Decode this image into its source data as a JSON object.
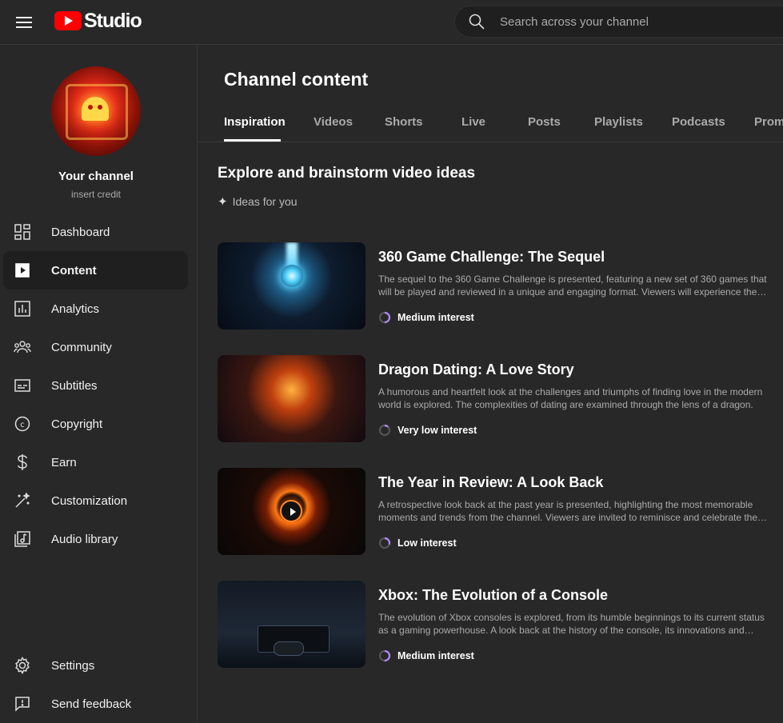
{
  "app": {
    "logo_text": "Studio",
    "brand_color": "#ff0000"
  },
  "search": {
    "placeholder": "Search across your channel"
  },
  "channel": {
    "name": "Your channel",
    "subtitle": "insert credit"
  },
  "sidebar": {
    "items": [
      {
        "label": "Dashboard",
        "icon": "dashboard-icon"
      },
      {
        "label": "Content",
        "icon": "content-icon",
        "active": true
      },
      {
        "label": "Analytics",
        "icon": "analytics-icon"
      },
      {
        "label": "Community",
        "icon": "community-icon"
      },
      {
        "label": "Subtitles",
        "icon": "subtitles-icon"
      },
      {
        "label": "Copyright",
        "icon": "copyright-icon"
      },
      {
        "label": "Earn",
        "icon": "dollar-icon"
      },
      {
        "label": "Customization",
        "icon": "magic-wand-icon"
      },
      {
        "label": "Audio library",
        "icon": "audio-library-icon"
      }
    ],
    "footer": [
      {
        "label": "Settings",
        "icon": "gear-icon"
      },
      {
        "label": "Send feedback",
        "icon": "feedback-icon"
      }
    ]
  },
  "main": {
    "title": "Channel content",
    "tabs": [
      "Inspiration",
      "Videos",
      "Shorts",
      "Live",
      "Posts",
      "Playlists",
      "Podcasts",
      "Prom"
    ],
    "active_tab": "Inspiration",
    "section_title": "Explore and brainstorm video ideas",
    "ideas_label": "Ideas for you",
    "ideas": [
      {
        "title": "360 Game Challenge: The Sequel",
        "description": "The sequel to the 360 Game Challenge is presented, featuring a new set of 360 games that will be played and reviewed in a unique and engaging format. Viewers will experience the excitement of discovering new titles.",
        "interest": "Medium interest",
        "interest_level": 0.5
      },
      {
        "title": "Dragon Dating: A Love Story",
        "description": "A humorous and heartfelt look at the challenges and triumphs of finding love in the modern world is explored. The complexities of dating are examined through the lens of a dragon.",
        "interest": "Very low interest",
        "interest_level": 0.12
      },
      {
        "title": "The Year in Review: A Look Back",
        "description": "A retrospective look back at the past year is presented, highlighting the most memorable moments and trends from the channel. Viewers are invited to reminisce and celebrate the year together.",
        "interest": "Low interest",
        "interest_level": 0.3
      },
      {
        "title": "Xbox: The Evolution of a Console",
        "description": "The evolution of Xbox consoles is explored, from its humble beginnings to its current status as a gaming powerhouse. A look back at the history of the console, its innovations and legacy.",
        "interest": "Medium interest",
        "interest_level": 0.5
      }
    ]
  },
  "colors": {
    "accent_interest": "#b388ff",
    "ring_track": "#555555"
  }
}
